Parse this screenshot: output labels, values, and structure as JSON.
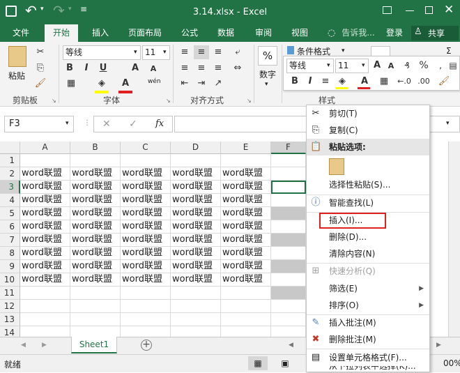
{
  "title_bar": {
    "file_title": "3.14.xlsx - Excel",
    "undo_icon": "↶",
    "redo_icon": "↷"
  },
  "tabs": [
    {
      "label": "文件"
    },
    {
      "label": "开始"
    },
    {
      "label": "插入"
    },
    {
      "label": "页面布局"
    },
    {
      "label": "公式"
    },
    {
      "label": "数据"
    },
    {
      "label": "审阅"
    },
    {
      "label": "视图"
    }
  ],
  "tell_me": "告诉我...",
  "signin": "登录",
  "share": "共享",
  "ribbon": {
    "paste": "粘贴",
    "clipboard": "剪贴板",
    "font_name": "等线",
    "font_size": "11",
    "font_group": "字体",
    "wen": "wén",
    "align_group": "对齐方式",
    "number": "数字",
    "cond_format": "条件格式",
    "styles_group": "样式"
  },
  "mini_toolbar": {
    "font_name": "等线",
    "font_size": "11"
  },
  "formula_bar": {
    "name_box": "F3",
    "fx": "fx"
  },
  "columns": [
    "A",
    "B",
    "C",
    "D",
    "E",
    "F"
  ],
  "rows": [
    "1",
    "2",
    "3",
    "4",
    "5",
    "6",
    "7",
    "8",
    "9",
    "10",
    "11",
    "12",
    "13",
    "14"
  ],
  "cell_text": "word联盟",
  "sheet_tab": "Sheet1",
  "status": {
    "ready": "就绪",
    "zoom": "00%"
  },
  "context_menu": {
    "cut": "剪切(T)",
    "copy": "复制(C)",
    "paste_options": "粘贴选项:",
    "paste_special": "选择性粘贴(S)...",
    "smart_lookup": "智能查找(L)",
    "insert": "插入(I)...",
    "delete": "删除(D)...",
    "clear": "清除内容(N)",
    "quick_analysis": "快速分析(Q)",
    "filter": "筛选(E)",
    "sort": "排序(O)",
    "insert_comment": "插入批注(M)",
    "delete_comment": "删除批注(M)",
    "format_cells": "设置单元格格式(F)...",
    "pick_list": "从下拉列表中选择(K)..."
  },
  "colors": {
    "excel_green": "#217346",
    "highlight_red": "#e02020"
  }
}
